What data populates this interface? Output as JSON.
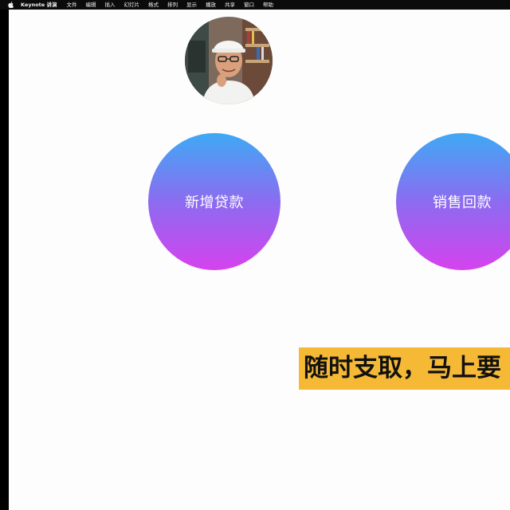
{
  "menubar": {
    "app_name": "Keynote 讲演",
    "items": [
      "文件",
      "编辑",
      "插入",
      "幻灯片",
      "格式",
      "排列",
      "显示",
      "播放",
      "共享",
      "窗口",
      "帮助"
    ]
  },
  "slide": {
    "buttons": [
      {
        "label": "新增贷款"
      },
      {
        "label": "销售回款"
      }
    ],
    "caption": "随时支取，马上要"
  },
  "colors": {
    "gradient_top": "#3fa9f5",
    "gradient_mid": "#8b6cf0",
    "gradient_bottom": "#d642ee",
    "caption_bg": "#f5b935",
    "slide_bg": "#fdfdfd"
  }
}
